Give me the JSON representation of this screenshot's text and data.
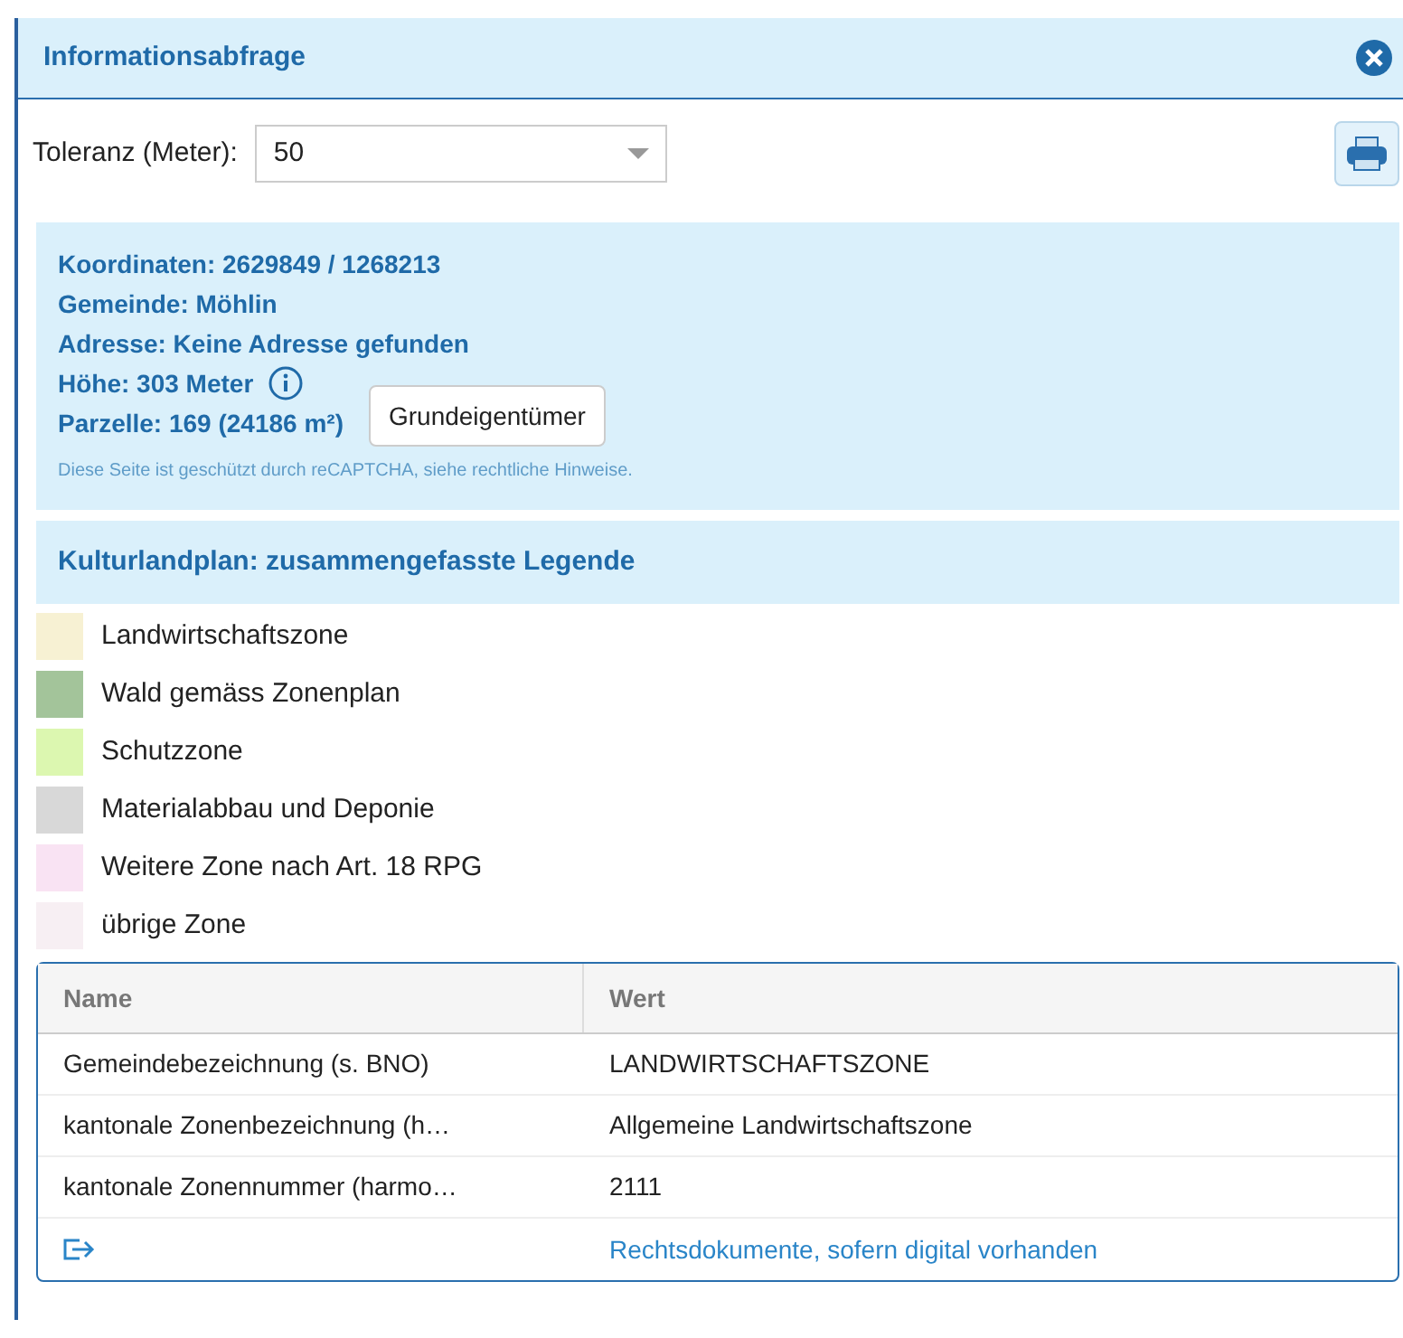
{
  "panel": {
    "title": "Informationsabfrage"
  },
  "tolerance": {
    "label": "Toleranz (Meter):",
    "value": "50"
  },
  "info": {
    "lines": [
      "Koordinaten: 2629849 / 1268213",
      "Gemeinde: Möhlin",
      "Adresse: Keine Adresse gefunden",
      "Höhe: 303 Meter",
      "Parzelle: 169 (24186 m²)"
    ],
    "owner_button": "Grundeigentümer",
    "captcha_text": "Diese Seite ist geschützt durch reCAPTCHA, siehe",
    "captcha_link": "rechtliche Hinweise",
    "captcha_end": "."
  },
  "legend": {
    "title": "Kulturlandplan: zusammengefasste Legende",
    "items": [
      {
        "label": "Landwirtschaftszone",
        "color": "#f7f1d3"
      },
      {
        "label": "Wald gemäss Zonenplan",
        "color": "#a3c49a"
      },
      {
        "label": "Schutzzone",
        "color": "#dcf7b0"
      },
      {
        "label": "Materialabbau und Deponie",
        "color": "#d8d8d8"
      },
      {
        "label": "Weitere Zone nach Art. 18 RPG",
        "color": "#f9e3f3"
      },
      {
        "label": "übrige Zone",
        "color": "#f7eff3"
      }
    ]
  },
  "table": {
    "columns": [
      "Name",
      "Wert"
    ],
    "rows": [
      {
        "name": "Gemeindebezeichnung (s. BNO)",
        "value": "LANDWIRTSCHAFTSZONE"
      },
      {
        "name": "kantonale Zonenbezeichnung (h…",
        "value": "Allgemeine Landwirtschaftszone"
      },
      {
        "name": "kantonale Zonennummer (harmo…",
        "value": "2111"
      }
    ],
    "link": "Rechtsdokumente, sofern digital vorhanden"
  }
}
